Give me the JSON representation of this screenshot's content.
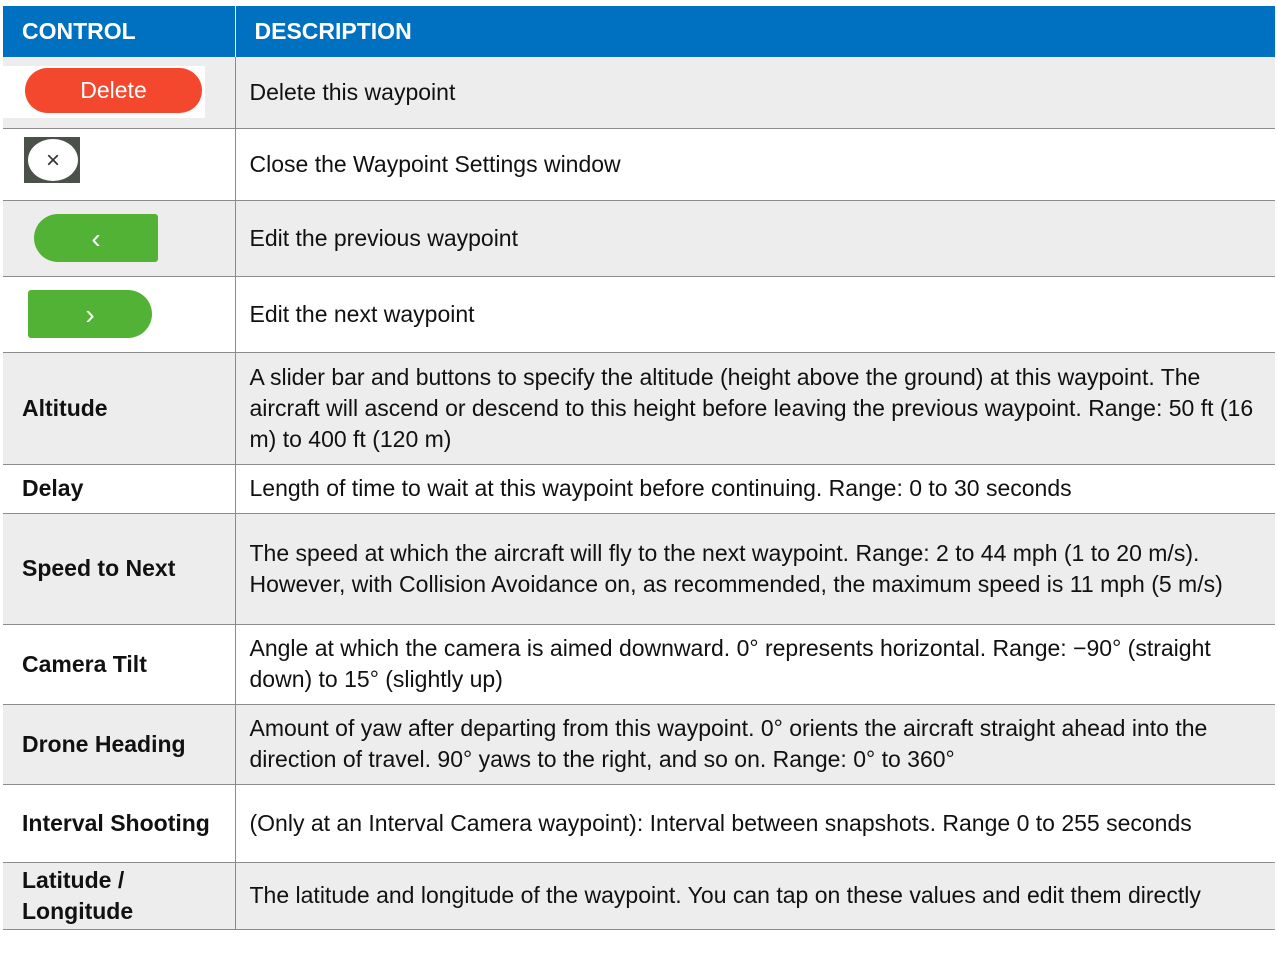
{
  "header": {
    "control": "CONTROL",
    "description": "DESCRIPTION"
  },
  "icons": {
    "delete_label": "Delete",
    "close_glyph": "×",
    "prev_glyph": "‹",
    "next_glyph": "›"
  },
  "rows": [
    {
      "control": "",
      "description": "Delete this waypoint"
    },
    {
      "control": "",
      "description": "Close the Waypoint Settings window"
    },
    {
      "control": "",
      "description": "Edit the previous waypoint"
    },
    {
      "control": "",
      "description": "Edit the next waypoint"
    },
    {
      "control": "Altitude",
      "description": "A slider bar and buttons to specify the altitude (height above the ground) at this waypoint. The aircraft will ascend or descend to this height before leaving the previous waypoint. Range: 50 ft (16 m) to 400 ft (120 m)"
    },
    {
      "control": "Delay",
      "description": "Length of time to wait at this waypoint before continuing. Range: 0 to 30 seconds"
    },
    {
      "control": "Speed to Next",
      "description": "The speed at which the aircraft will fly to the next waypoint. Range: 2 to 44 mph (1 to 20 m/s). However, with Collision Avoidance on, as recommended, the maximum speed is 11 mph (5 m/s)"
    },
    {
      "control": "Camera Tilt",
      "description": "Angle at which the camera is aimed downward. 0° represents horizontal. Range: −90° (straight down) to 15° (slightly up)"
    },
    {
      "control": "Drone Heading",
      "description": "Amount of yaw after departing from this waypoint. 0° orients the aircraft straight ahead into the direction of travel. 90° yaws to the right, and so on. Range: 0° to 360°"
    },
    {
      "control": "Interval Shooting",
      "description": "(Only at an Interval Camera waypoint): Interval between snapshots. Range 0 to 255 seconds"
    },
    {
      "control": "Latitude / Longitude",
      "description": "The latitude and longitude of the waypoint. You can tap on these values and edit them directly"
    }
  ],
  "colors": {
    "header_bg": "#0070c0",
    "alt_row_bg": "#ededed",
    "delete_red": "#f4482e",
    "nav_green": "#52b236"
  }
}
